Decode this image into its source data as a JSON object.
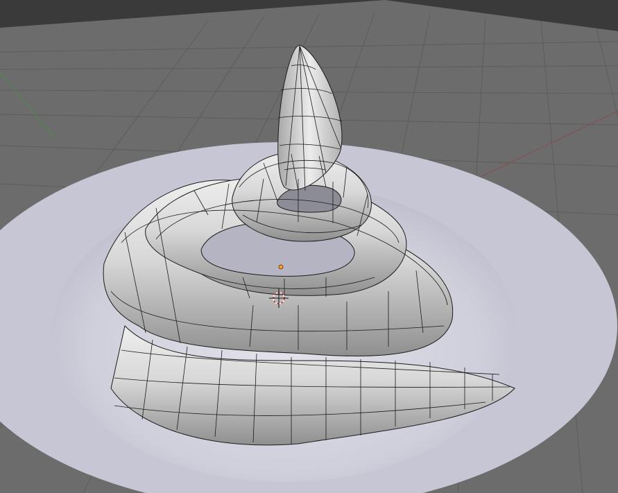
{
  "viewport": {
    "editor": "3d-viewport",
    "mode": "edit-mode",
    "colors": {
      "background": "#3d3d3d",
      "floor": "#6b6b6b",
      "grid_line": "#5a5a5a",
      "x_axis": "#8a4a4a",
      "y_axis": "#4a8a4a",
      "plate": "#c9c9d6",
      "plate_center": "#dcdce6",
      "mesh_light": "#e4e4e4",
      "mesh_shade": "#9a9a9a",
      "wire": "#1a1a1a",
      "origin": "#ff9a30",
      "cursor": "#d02020"
    },
    "objects": [
      {
        "name": "plate-disc",
        "kind": "mesh"
      },
      {
        "name": "coiled-tube-mesh",
        "kind": "mesh",
        "selected": true
      }
    ],
    "overlays": [
      "object-origin-dot",
      "3d-cursor-icon"
    ]
  }
}
